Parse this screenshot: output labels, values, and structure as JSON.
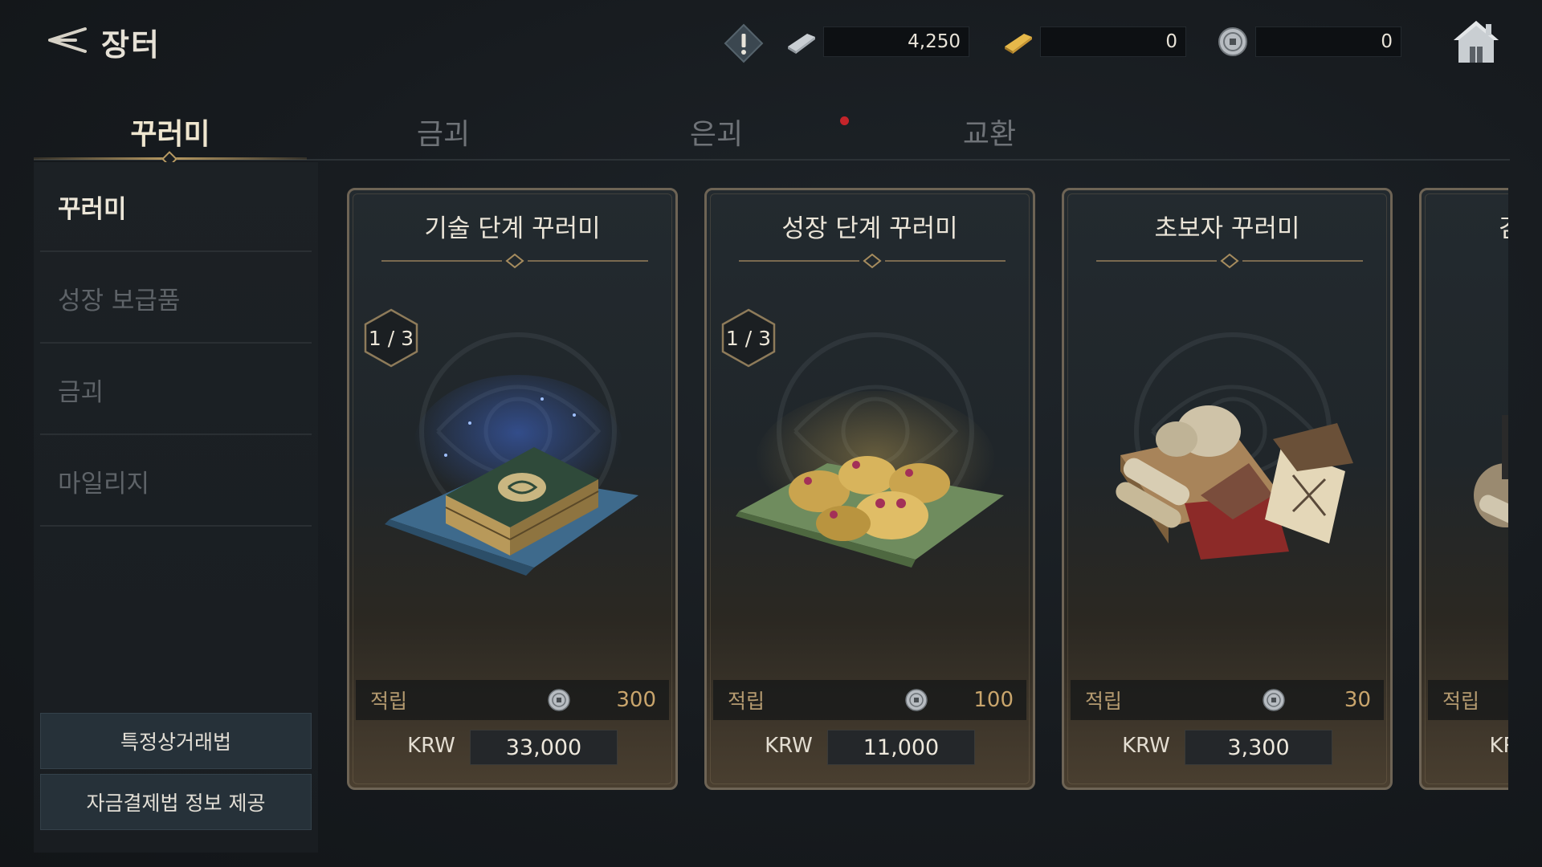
{
  "header": {
    "title": "장터",
    "currencies": [
      {
        "name": "silver",
        "value": "4,250"
      },
      {
        "name": "gold",
        "value": "0"
      },
      {
        "name": "coin",
        "value": "0"
      }
    ]
  },
  "tabs": [
    {
      "label": "꾸러미",
      "active": true
    },
    {
      "label": "금괴",
      "active": false
    },
    {
      "label": "은괴",
      "active": false
    },
    {
      "label": "교환",
      "active": false
    }
  ],
  "sidebar": {
    "items": [
      {
        "label": "꾸러미",
        "active": true
      },
      {
        "label": "성장 보급품",
        "active": false
      },
      {
        "label": "금괴",
        "active": false
      },
      {
        "label": "마일리지",
        "active": false
      }
    ],
    "buttons": [
      "특정상거래법",
      "자금결제법 정보 제공"
    ]
  },
  "cards": [
    {
      "title": "기술 단계 꾸러미",
      "badge": "1 / 3",
      "reward_label": "적립",
      "reward_value": "300",
      "currency": "KRW",
      "price": "33,000",
      "art": "scroll-bundle"
    },
    {
      "title": "성장 단계 꾸러미",
      "badge": "1 / 3",
      "reward_label": "적립",
      "reward_value": "100",
      "currency": "KRW",
      "price": "11,000",
      "art": "golden-toads"
    },
    {
      "title": "초보자 꾸러미",
      "badge": "",
      "reward_label": "적립",
      "reward_value": "30",
      "currency": "KRW",
      "price": "3,300",
      "art": "supply-bundle"
    },
    {
      "title": "김",
      "badge": "",
      "reward_label": "적립",
      "reward_value": "",
      "currency": "KR",
      "price": "",
      "art": "partial"
    }
  ],
  "colors": {
    "accent_gold": "#b89a62",
    "notification_red": "#c4242a",
    "reward_value": "#c9a56c"
  }
}
